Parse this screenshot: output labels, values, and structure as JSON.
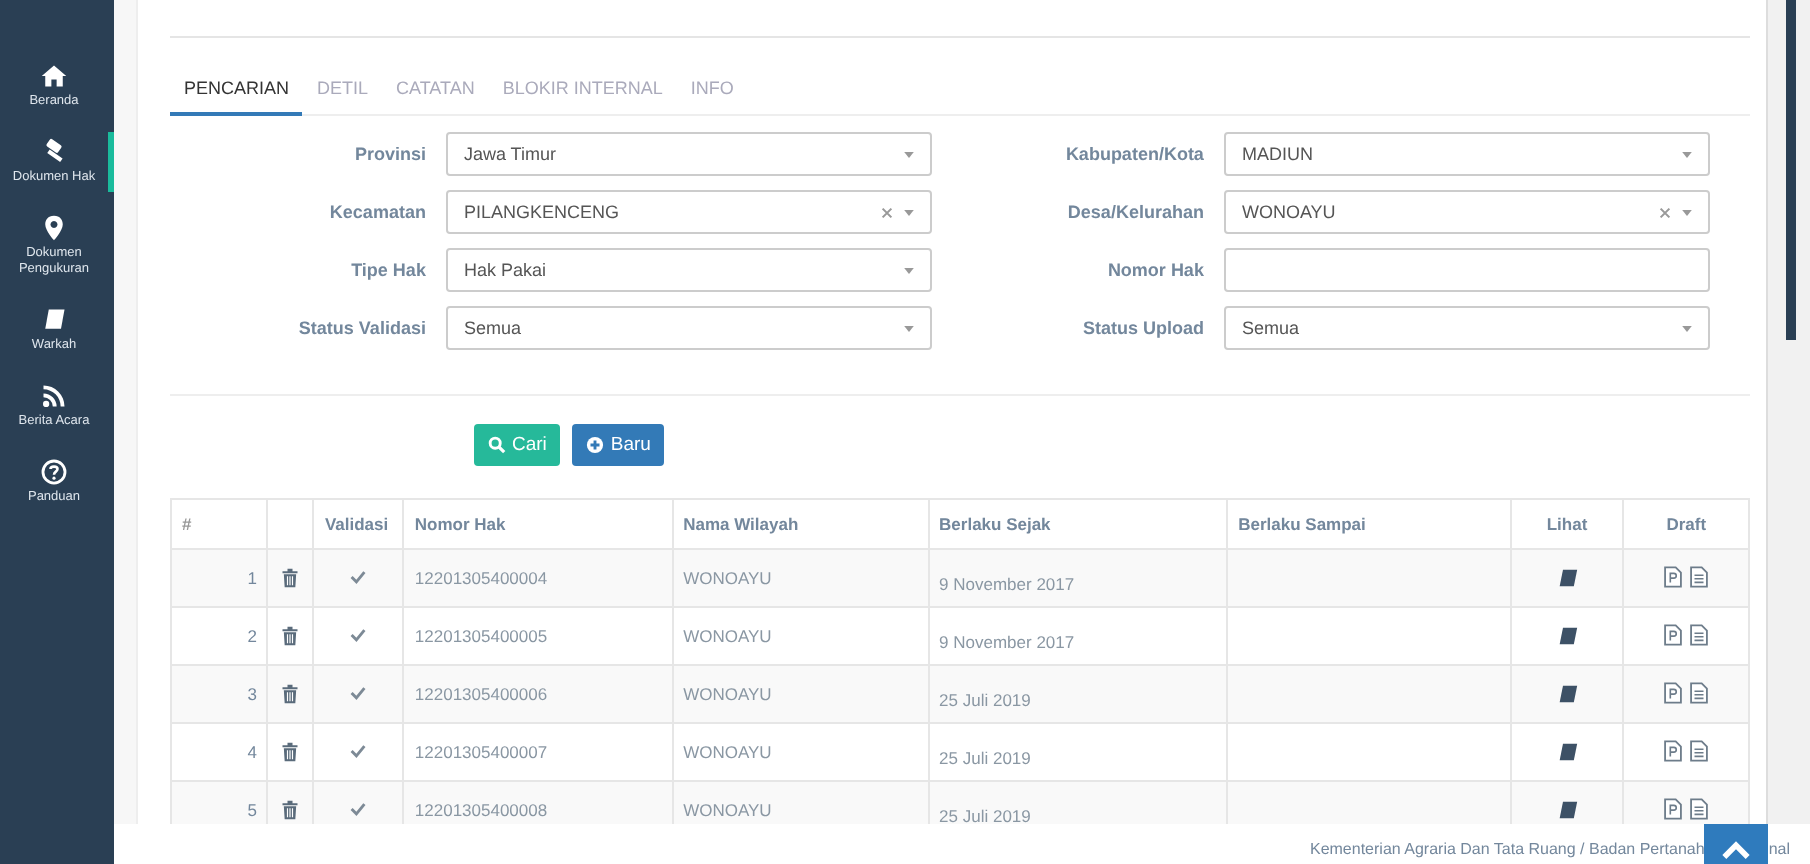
{
  "sidebar": {
    "items": [
      {
        "label": "Beranda",
        "selected": false
      },
      {
        "label": "Dokumen Hak",
        "selected": true
      },
      {
        "label": "Dokumen Pengukuran",
        "selected": false
      },
      {
        "label": "Warkah",
        "selected": false
      },
      {
        "label": "Berita Acara",
        "selected": false
      },
      {
        "label": "Panduan",
        "selected": false
      }
    ]
  },
  "tabs": [
    {
      "label": "PENCARIAN",
      "selected": true
    },
    {
      "label": "DETIL",
      "selected": false
    },
    {
      "label": "CATATAN",
      "selected": false
    },
    {
      "label": "BLOKIR INTERNAL",
      "selected": false
    },
    {
      "label": "INFO",
      "selected": false
    }
  ],
  "form": {
    "fields": [
      {
        "label": "Provinsi",
        "kind": "select",
        "value": "Jawa Timur",
        "clearable": false
      },
      {
        "label": "Kabupaten/Kota",
        "kind": "select",
        "value": "MADIUN",
        "clearable": false
      },
      {
        "label": "Kecamatan",
        "kind": "select",
        "value": "PILANGKENCENG",
        "clearable": true
      },
      {
        "label": "Desa/Kelurahan",
        "kind": "select",
        "value": "WONOAYU",
        "clearable": true
      },
      {
        "label": "Tipe Hak",
        "kind": "select",
        "value": "Hak Pakai",
        "clearable": false
      },
      {
        "label": "Nomor Hak",
        "kind": "text"
      },
      {
        "label": "Status Validasi",
        "kind": "select",
        "value": "Semua",
        "clearable": false
      },
      {
        "label": "Status Upload",
        "kind": "select",
        "value": "Semua",
        "clearable": false
      }
    ]
  },
  "buttons": [
    {
      "label": "Cari",
      "kind": "search"
    },
    {
      "label": "Baru",
      "kind": "new"
    }
  ],
  "table": {
    "columns": [
      "#",
      "Validasi",
      "Nomor Hak",
      "Nama Wilayah",
      "Berlaku Sejak",
      "Berlaku Sampai",
      "Lihat",
      "Draft"
    ],
    "rows": [
      {
        "no": "1",
        "validated": true,
        "nomor_hak": "12201305400004",
        "nama_wilayah": "WONOAYU",
        "berlaku_sejak": "9 November 2017"
      },
      {
        "no": "2",
        "validated": true,
        "nomor_hak": "12201305400005",
        "nama_wilayah": "WONOAYU",
        "berlaku_sejak": "9 November 2017"
      },
      {
        "no": "3",
        "validated": true,
        "nomor_hak": "12201305400006",
        "nama_wilayah": "WONOAYU",
        "berlaku_sejak": "25 Juli 2019"
      },
      {
        "no": "4",
        "validated": true,
        "nomor_hak": "12201305400007",
        "nama_wilayah": "WONOAYU",
        "berlaku_sejak": "25 Juli 2019"
      },
      {
        "no": "5",
        "validated": true,
        "nomor_hak": "12201305400008",
        "nama_wilayah": "WONOAYU",
        "berlaku_sejak": "25 Juli 2019"
      }
    ]
  },
  "footer": {
    "text": "Kementerian Agraria Dan Tata Ruang / Badan Pertanah",
    "text_after": "nal"
  }
}
